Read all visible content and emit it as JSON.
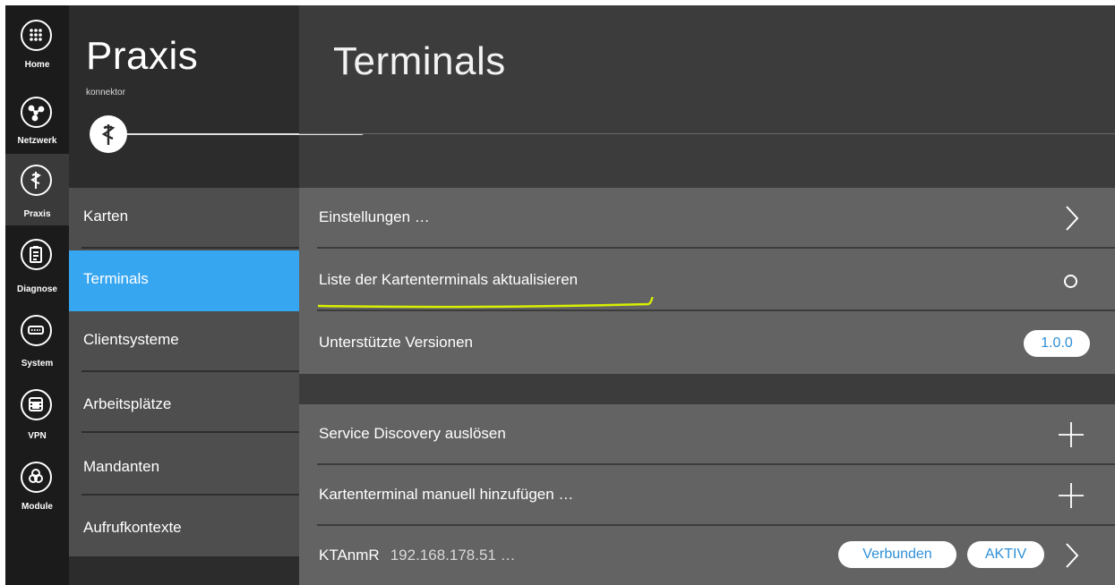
{
  "rail": {
    "items": [
      {
        "label": "Home",
        "icon": "grid-icon"
      },
      {
        "label": "Netzwerk",
        "icon": "network-icon"
      },
      {
        "label": "Praxis",
        "icon": "caduceus-icon"
      },
      {
        "label": "Diagnose",
        "icon": "clipboard-icon"
      },
      {
        "label": "System",
        "icon": "device-icon"
      },
      {
        "label": "VPN",
        "icon": "vpn-icon"
      },
      {
        "label": "Module",
        "icon": "modules-icon"
      }
    ]
  },
  "brand": {
    "title": "Praxis",
    "subtitle": "konnektor",
    "icon": "caduceus-icon"
  },
  "subnav": {
    "items": [
      {
        "label": "Karten"
      },
      {
        "label": "Terminals",
        "active": true
      },
      {
        "label": "Clientsysteme"
      },
      {
        "label": "Arbeitsplätze"
      },
      {
        "label": "Mandanten"
      },
      {
        "label": "Aufrufkontexte"
      }
    ]
  },
  "main": {
    "title": "Terminals",
    "settings": [
      {
        "label": "Einstellungen …",
        "control": "chevron-right-icon"
      },
      {
        "label": "Liste der Kartenterminals aktualisieren",
        "control": "circle-icon",
        "highlighted": true
      },
      {
        "label": "Unterstützte Versionen",
        "badge": "1.0.0"
      }
    ],
    "actions": [
      {
        "label": "Service Discovery auslösen",
        "control": "plus-icon"
      },
      {
        "label": "Kartenterminal manuell hinzufügen …",
        "control": "plus-icon"
      }
    ],
    "terminal": {
      "name": "KTAnmR",
      "address": "192.168.178.51 …",
      "status": "Verbunden",
      "state": "AKTIV",
      "control": "chevron-right-icon"
    }
  },
  "colors": {
    "accent": "#37a6f0",
    "highlight_stroke": "#d7f000",
    "rail_bg": "#1b1b1b",
    "panel_bg": "#636363"
  }
}
